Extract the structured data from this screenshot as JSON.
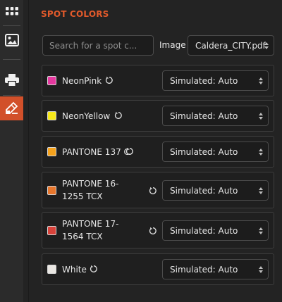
{
  "header": {
    "title": "SPOT COLORS"
  },
  "search": {
    "placeholder": "Search for a spot c..."
  },
  "image": {
    "label": "Image",
    "selected": "Caldera_CITY.pdf"
  },
  "colors": [
    {
      "name": "NeonPink",
      "swatch": "#e5389f",
      "mode": "Simulated: Auto"
    },
    {
      "name": "NeonYellow",
      "swatch": "#f6e81a",
      "mode": "Simulated: Auto"
    },
    {
      "name": "PANTONE 137 C",
      "swatch": "#f5a21c",
      "mode": "Simulated: Auto"
    },
    {
      "name": "PANTONE 16-1255 TCX",
      "swatch": "#e8762c",
      "mode": "Simulated: Auto"
    },
    {
      "name": "PANTONE 17-1564 TCX",
      "swatch": "#d8423a",
      "mode": "Simulated: Auto"
    },
    {
      "name": "White",
      "swatch": "#e9e6e2",
      "mode": "Simulated: Auto"
    }
  ],
  "rail": {
    "items": [
      {
        "icon": "apps-grid-icon"
      },
      {
        "icon": "image-icon"
      },
      {
        "icon": "printer-icon"
      },
      {
        "icon": "spot-color-icon",
        "active": true
      }
    ],
    "accent": "#d2502a"
  }
}
